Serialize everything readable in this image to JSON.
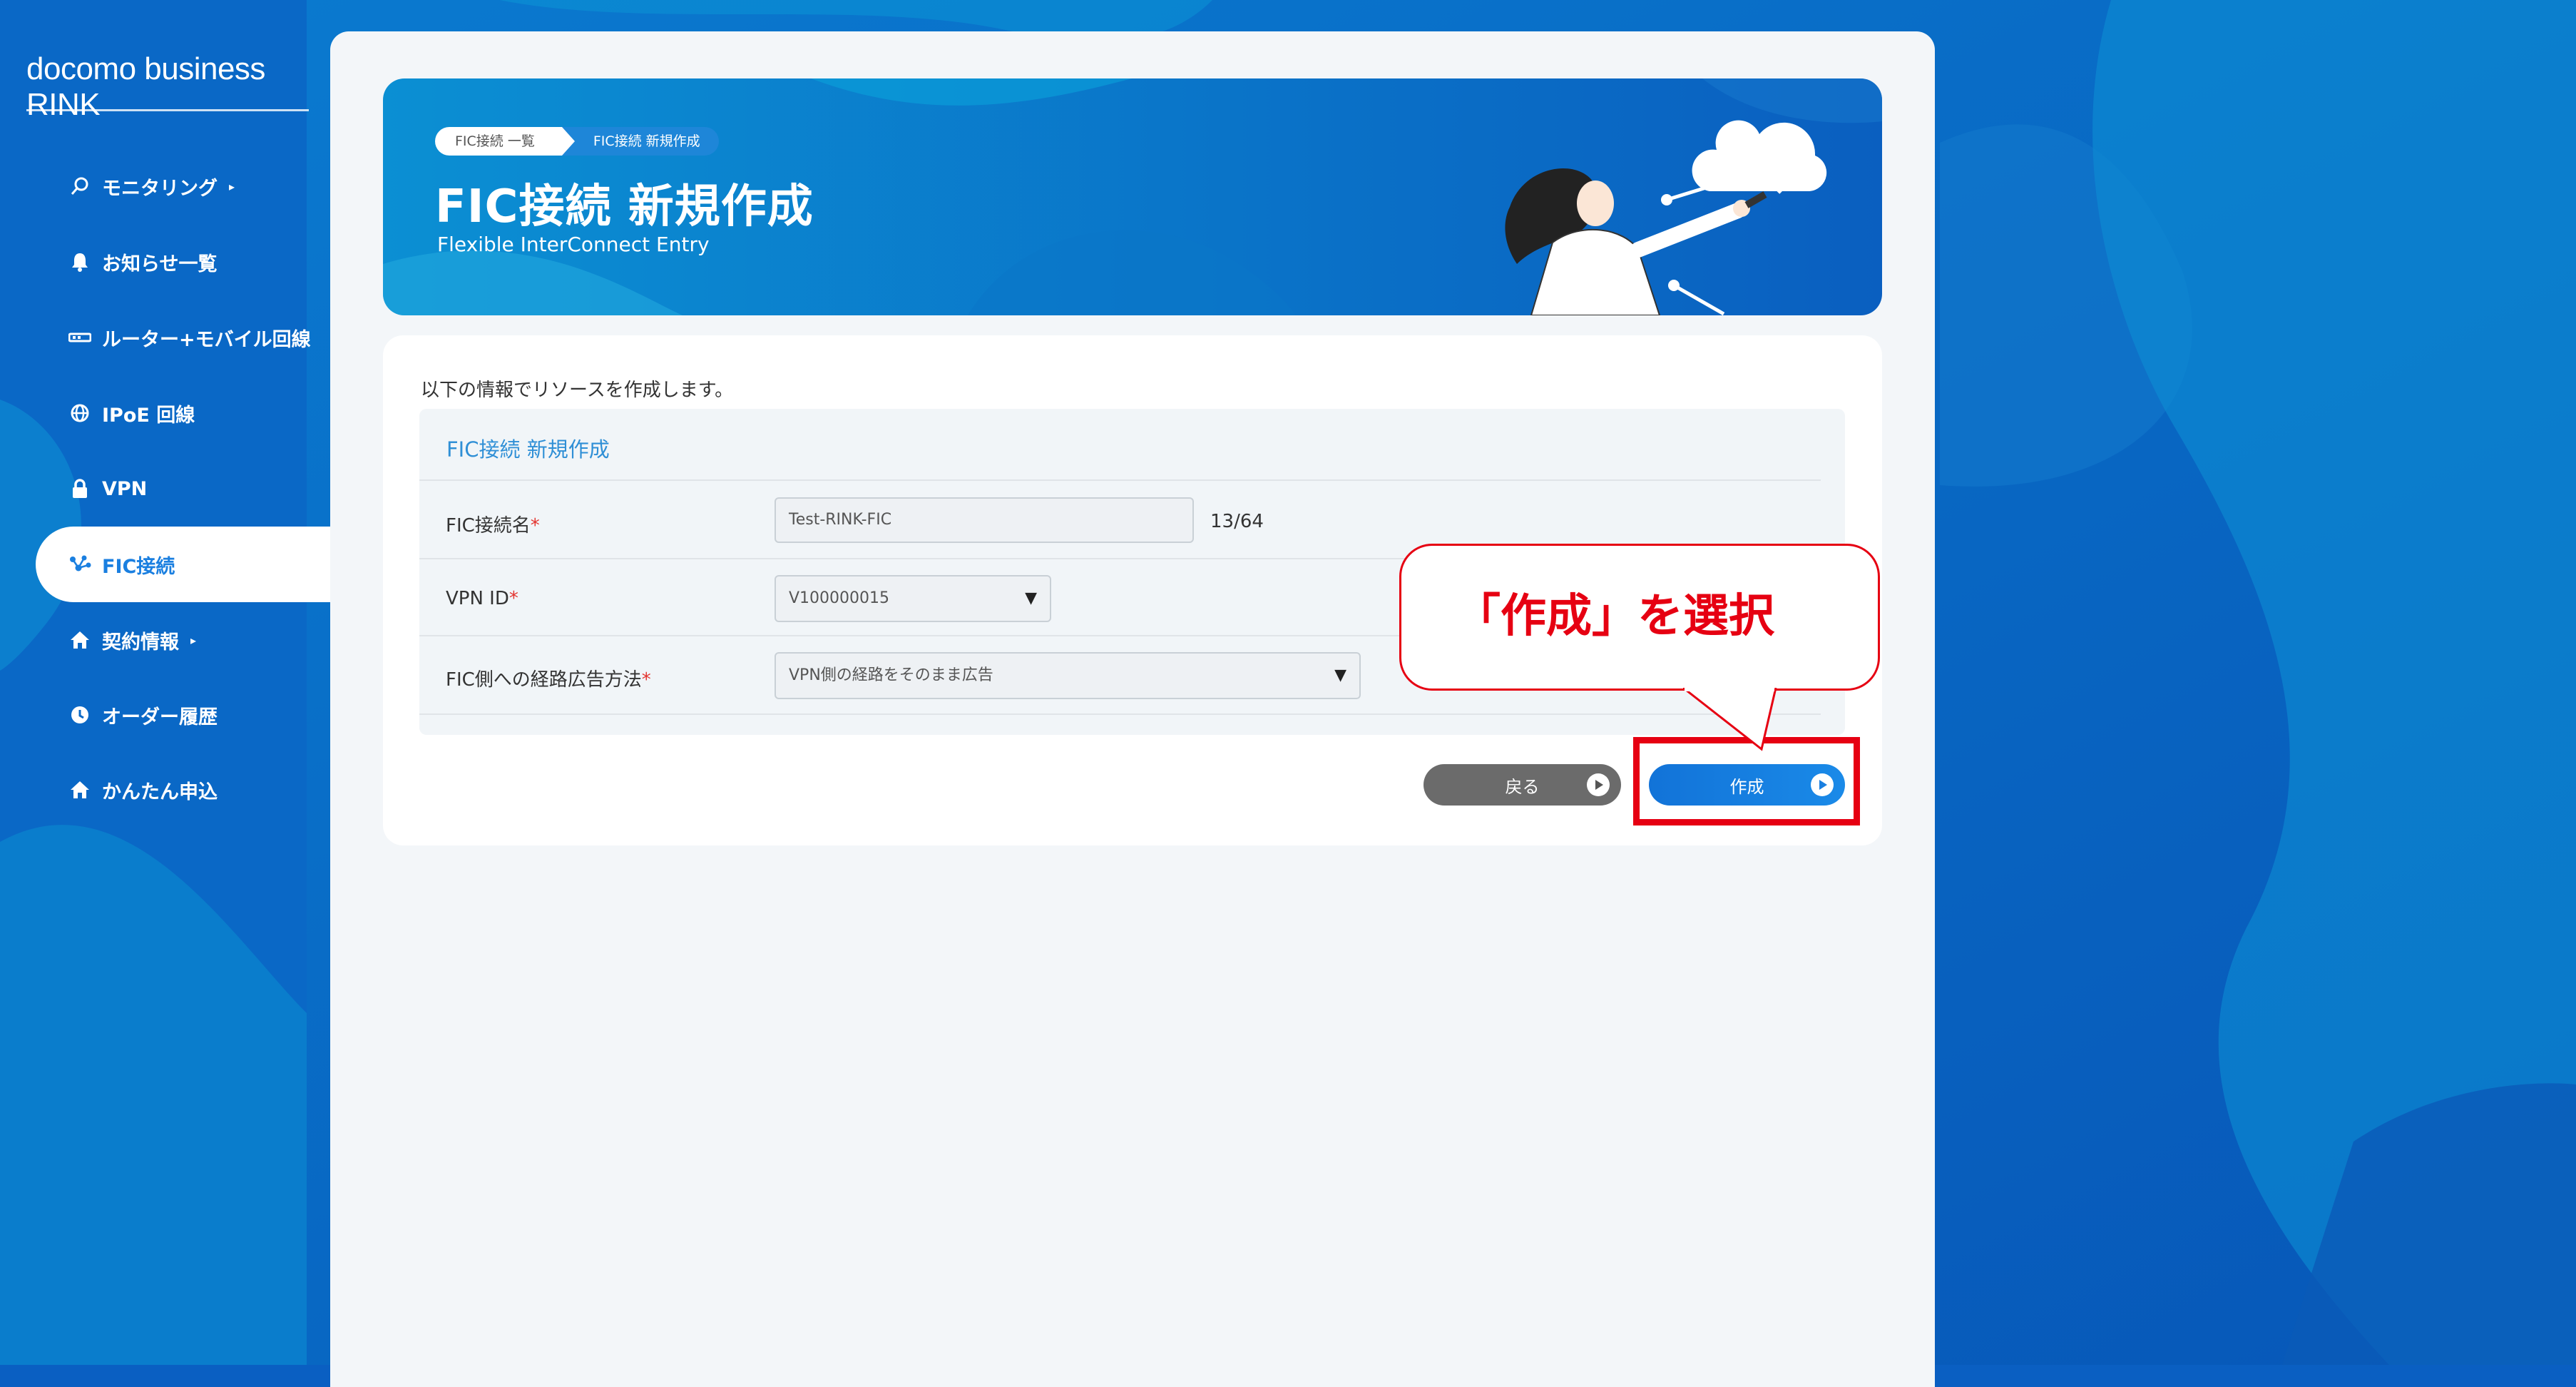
{
  "app": {
    "brand": "docomo business RINK"
  },
  "sidebar": {
    "items": [
      {
        "label": "モニタリング",
        "icon": "monitoring-icon",
        "caret": "▸"
      },
      {
        "label": "お知らせ一覧",
        "icon": "bell-icon"
      },
      {
        "label": "ルーター+モバイル回線",
        "icon": "router-icon"
      },
      {
        "label": "IPoE 回線",
        "icon": "globe-icon"
      },
      {
        "label": "VPN",
        "icon": "lock-icon"
      },
      {
        "label": "FIC接続",
        "icon": "network-icon",
        "active": true
      },
      {
        "label": "契約情報",
        "icon": "home-icon",
        "caret": "▸"
      },
      {
        "label": "オーダー履歴",
        "icon": "clock-icon"
      },
      {
        "label": "かんたん申込",
        "icon": "home-icon"
      }
    ]
  },
  "header": {
    "breadcrumb": [
      "FIC接続 一覧",
      "FIC接続 新規作成"
    ],
    "title": "FIC接続 新規作成",
    "subtitle": "Flexible InterConnect Entry"
  },
  "main": {
    "intro": "以下の情報でリソースを作成します。",
    "form_title": "FIC接続 新規作成",
    "fields": {
      "name": {
        "label": "FIC接続名",
        "value": "Test-RINK-FIC",
        "count": "13/64"
      },
      "vpn": {
        "label": "VPN ID",
        "value": "V100000015"
      },
      "advertise": {
        "label": "FIC側への経路広告方法",
        "value": "VPN側の経路をそのまま広告"
      }
    },
    "required_mark": "*",
    "select_arrow": "▼",
    "buttons": {
      "back": "戻る",
      "create": "作成"
    }
  },
  "annotation": {
    "callout": "「作成」を選択",
    "color": "#e60012"
  }
}
